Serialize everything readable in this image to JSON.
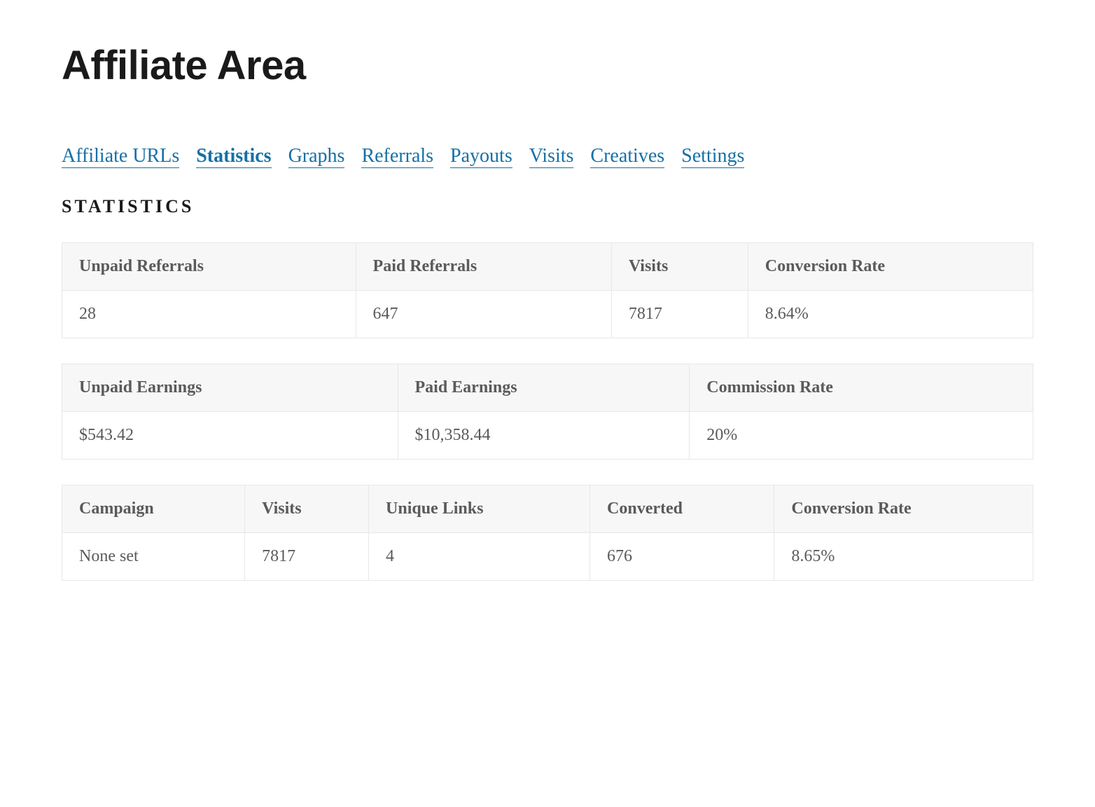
{
  "page": {
    "title": "Affiliate Area"
  },
  "tabs": [
    {
      "label": "Affiliate URLs",
      "active": false
    },
    {
      "label": "Statistics",
      "active": true
    },
    {
      "label": "Graphs",
      "active": false
    },
    {
      "label": "Referrals",
      "active": false
    },
    {
      "label": "Payouts",
      "active": false
    },
    {
      "label": "Visits",
      "active": false
    },
    {
      "label": "Creatives",
      "active": false
    },
    {
      "label": "Settings",
      "active": false
    }
  ],
  "section": {
    "title": "STATISTICS"
  },
  "referrals_table": {
    "headers": [
      "Unpaid Referrals",
      "Paid Referrals",
      "Visits",
      "Conversion Rate"
    ],
    "rows": [
      [
        "28",
        "647",
        "7817",
        "8.64%"
      ]
    ]
  },
  "earnings_table": {
    "headers": [
      "Unpaid Earnings",
      "Paid Earnings",
      "Commission Rate"
    ],
    "rows": [
      [
        "$543.42",
        "$10,358.44",
        "20%"
      ]
    ]
  },
  "campaign_table": {
    "headers": [
      "Campaign",
      "Visits",
      "Unique Links",
      "Converted",
      "Conversion Rate"
    ],
    "rows": [
      [
        "None set",
        "7817",
        "4",
        "676",
        "8.65%"
      ]
    ]
  }
}
